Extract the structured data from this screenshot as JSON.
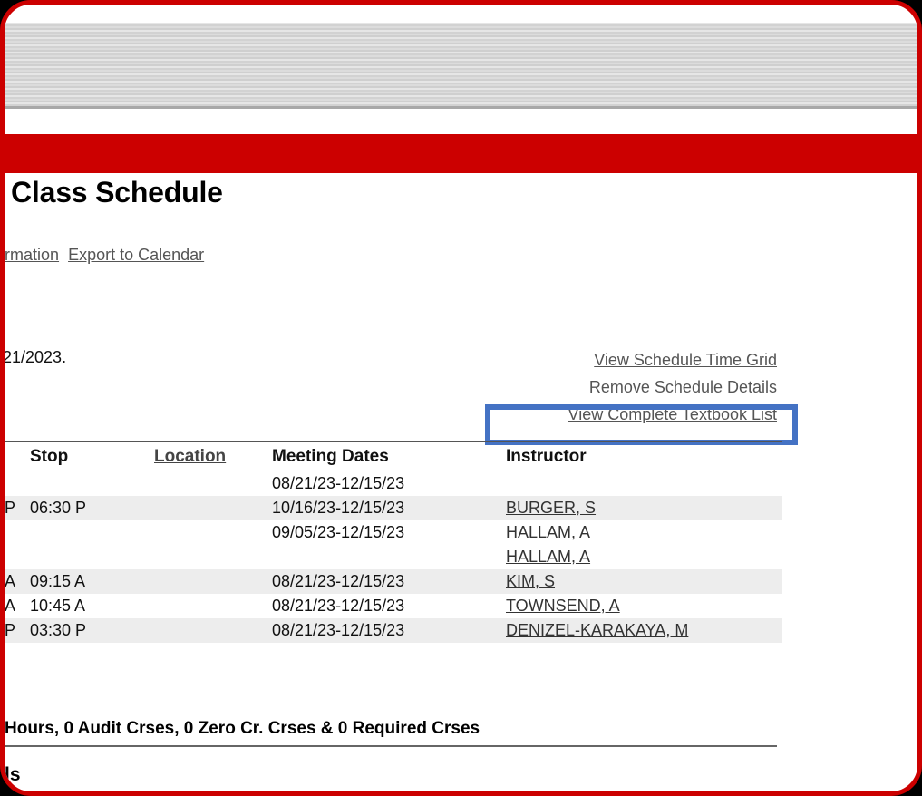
{
  "window": {
    "border_color": "#cc0000",
    "accent_band_color": "#cc0000",
    "highlight_color": "#4472c4"
  },
  "header": {
    "page_title": "Class Schedule"
  },
  "nav_links": [
    {
      "label": "tment Information",
      "name": "nav-link-payment-information"
    },
    {
      "label": "Export to Calendar",
      "name": "nav-link-export-to-calendar"
    }
  ],
  "term_note": "21/2023.",
  "action_links": [
    {
      "label": "View Schedule Time Grid",
      "name": "link-view-schedule-time-grid",
      "underlined": true
    },
    {
      "label": "Remove Schedule Details",
      "name": "link-remove-schedule-details",
      "underlined": false
    },
    {
      "label": "View Complete Textbook List",
      "name": "link-view-complete-textbook-list",
      "underlined": true
    }
  ],
  "table": {
    "headers": {
      "ampm": "",
      "stop": "Stop",
      "location": "Location",
      "meeting_dates": "Meeting Dates",
      "instructor": "Instructor"
    },
    "header_extra_row": {
      "ampm": "",
      "stop": "",
      "location": "",
      "meeting_dates": "08/21/23-12/15/23",
      "instructor": ""
    },
    "rows": [
      {
        "ampm": "P",
        "stop": "06:30 P",
        "location": "",
        "meeting_dates": "10/16/23-12/15/23",
        "instructor": "BURGER, S",
        "shaded": true
      },
      {
        "ampm": "",
        "stop": "",
        "location": "",
        "meeting_dates": "09/05/23-12/15/23",
        "instructor": "HALLAM, A",
        "shaded": false
      },
      {
        "ampm": "",
        "stop": "",
        "location": "",
        "meeting_dates": "",
        "instructor": "HALLAM, A",
        "shaded": false
      },
      {
        "ampm": "A",
        "stop": "09:15 A",
        "location": "",
        "meeting_dates": "08/21/23-12/15/23",
        "instructor": "KIM, S",
        "shaded": true
      },
      {
        "ampm": "A",
        "stop": "10:45 A",
        "location": "",
        "meeting_dates": "08/21/23-12/15/23",
        "instructor": "TOWNSEND, A",
        "shaded": false
      },
      {
        "ampm": "P",
        "stop": "03:30 P",
        "location": "",
        "meeting_dates": "08/21/23-12/15/23",
        "instructor": "DENIZEL-KARAKAYA, M",
        "shaded": true
      }
    ]
  },
  "footer": {
    "summary": "Hours, 0 Audit Crses, 0 Zero Cr. Crses & 0 Required Crses",
    "tail": "ls"
  }
}
